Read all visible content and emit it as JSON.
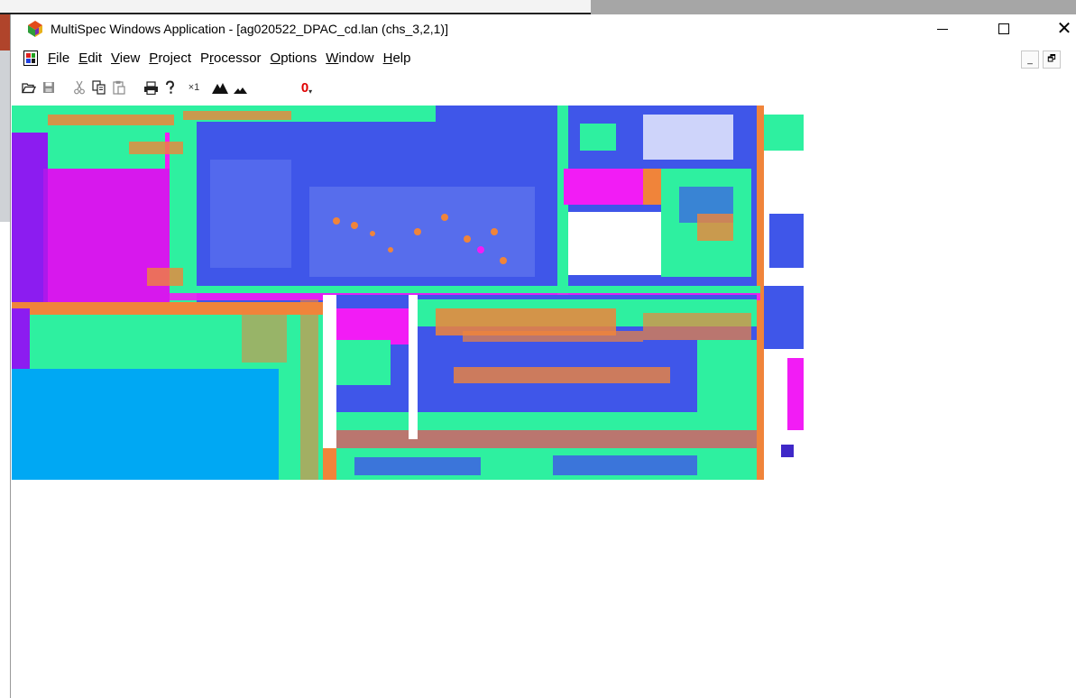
{
  "window": {
    "title": "MultiSpec Windows Application - [ag020522_DPAC_cd.lan (chs_3,2,1)]",
    "controls": {
      "minimize": "—",
      "maximize": "☐",
      "close": "✕"
    },
    "mdi_controls": {
      "minimize": "_",
      "restore": "🗗"
    }
  },
  "menubar": {
    "items": [
      {
        "hotkey": "F",
        "rest": "ile"
      },
      {
        "hotkey": "E",
        "rest": "dit"
      },
      {
        "hotkey": "V",
        "rest": "iew"
      },
      {
        "hotkey": "P",
        "rest": "roject"
      },
      {
        "pre": "P",
        "hotkey": "r",
        "rest": "ocessor"
      },
      {
        "hotkey": "O",
        "rest": "ptions"
      },
      {
        "hotkey": "W",
        "rest": "indow"
      },
      {
        "hotkey": "H",
        "rest": "elp"
      }
    ]
  },
  "toolbar": {
    "zoom_x1_label": "×1",
    "overlay_label": "0"
  },
  "icons": {
    "app": "multispec-app-icon",
    "document": "image-document-icon",
    "open": "open-folder-icon",
    "save": "save-disk-icon",
    "cut": "scissors-icon",
    "copy": "copy-icon",
    "paste": "clipboard-icon",
    "print": "printer-icon",
    "help": "context-help-icon",
    "zoom_in": "zoom-in-mountain-icon",
    "zoom_out": "zoom-out-mountain-icon",
    "overlay": "overlay-icon"
  },
  "colors": {
    "image_blue": "#3f56e9",
    "image_cyan": "#2ef0a0",
    "image_orange": "#f0843a",
    "image_magenta": "#f21cf5",
    "image_purple": "#8c1cf0",
    "image_fill_blue": "#00a8f3",
    "overlay_red": "#e00000"
  }
}
